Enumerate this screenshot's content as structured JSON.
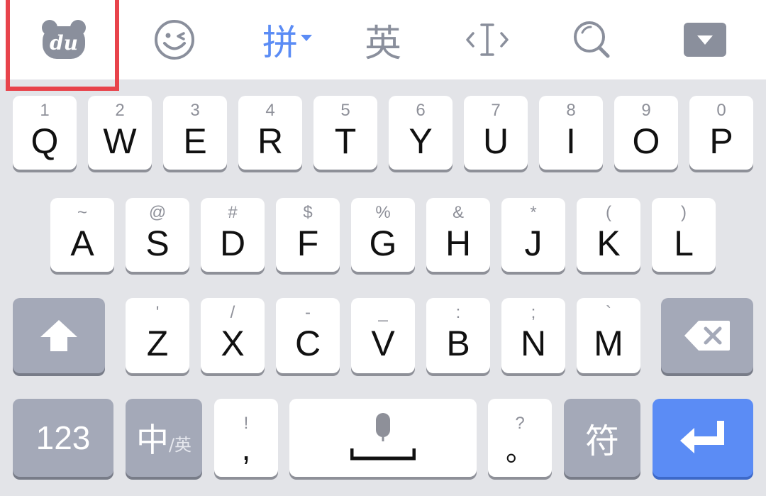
{
  "toolbar": {
    "logo_text": "du",
    "pinyin_label": "拼",
    "english_label": "英"
  },
  "rows": {
    "row1": [
      {
        "sub": "1",
        "main": "Q"
      },
      {
        "sub": "2",
        "main": "W"
      },
      {
        "sub": "3",
        "main": "E"
      },
      {
        "sub": "4",
        "main": "R"
      },
      {
        "sub": "5",
        "main": "T"
      },
      {
        "sub": "6",
        "main": "Y"
      },
      {
        "sub": "7",
        "main": "U"
      },
      {
        "sub": "8",
        "main": "I"
      },
      {
        "sub": "9",
        "main": "O"
      },
      {
        "sub": "0",
        "main": "P"
      }
    ],
    "row2": [
      {
        "sub": "~",
        "main": "A"
      },
      {
        "sub": "@",
        "main": "S"
      },
      {
        "sub": "#",
        "main": "D"
      },
      {
        "sub": "$",
        "main": "F"
      },
      {
        "sub": "%",
        "main": "G"
      },
      {
        "sub": "&",
        "main": "H"
      },
      {
        "sub": "*",
        "main": "J"
      },
      {
        "sub": "(",
        "main": "K"
      },
      {
        "sub": ")",
        "main": "L"
      }
    ],
    "row3": [
      {
        "sub": "'",
        "main": "Z"
      },
      {
        "sub": "/",
        "main": "X"
      },
      {
        "sub": "-",
        "main": "C"
      },
      {
        "sub": "_",
        "main": "V"
      },
      {
        "sub": ":",
        "main": "B"
      },
      {
        "sub": ";",
        "main": "N"
      },
      {
        "sub": "`",
        "main": "M"
      }
    ]
  },
  "bottom": {
    "num_label": "123",
    "lang_main": "中",
    "lang_sub": "/英",
    "comma_sub": "!",
    "comma_main": ",",
    "period_sub": "?",
    "period_main": "。",
    "symbol_label": "符"
  },
  "colors": {
    "accent_blue": "#5b8cf5",
    "highlight_red": "#e8434b",
    "icon_gray": "#8a8f9c"
  }
}
